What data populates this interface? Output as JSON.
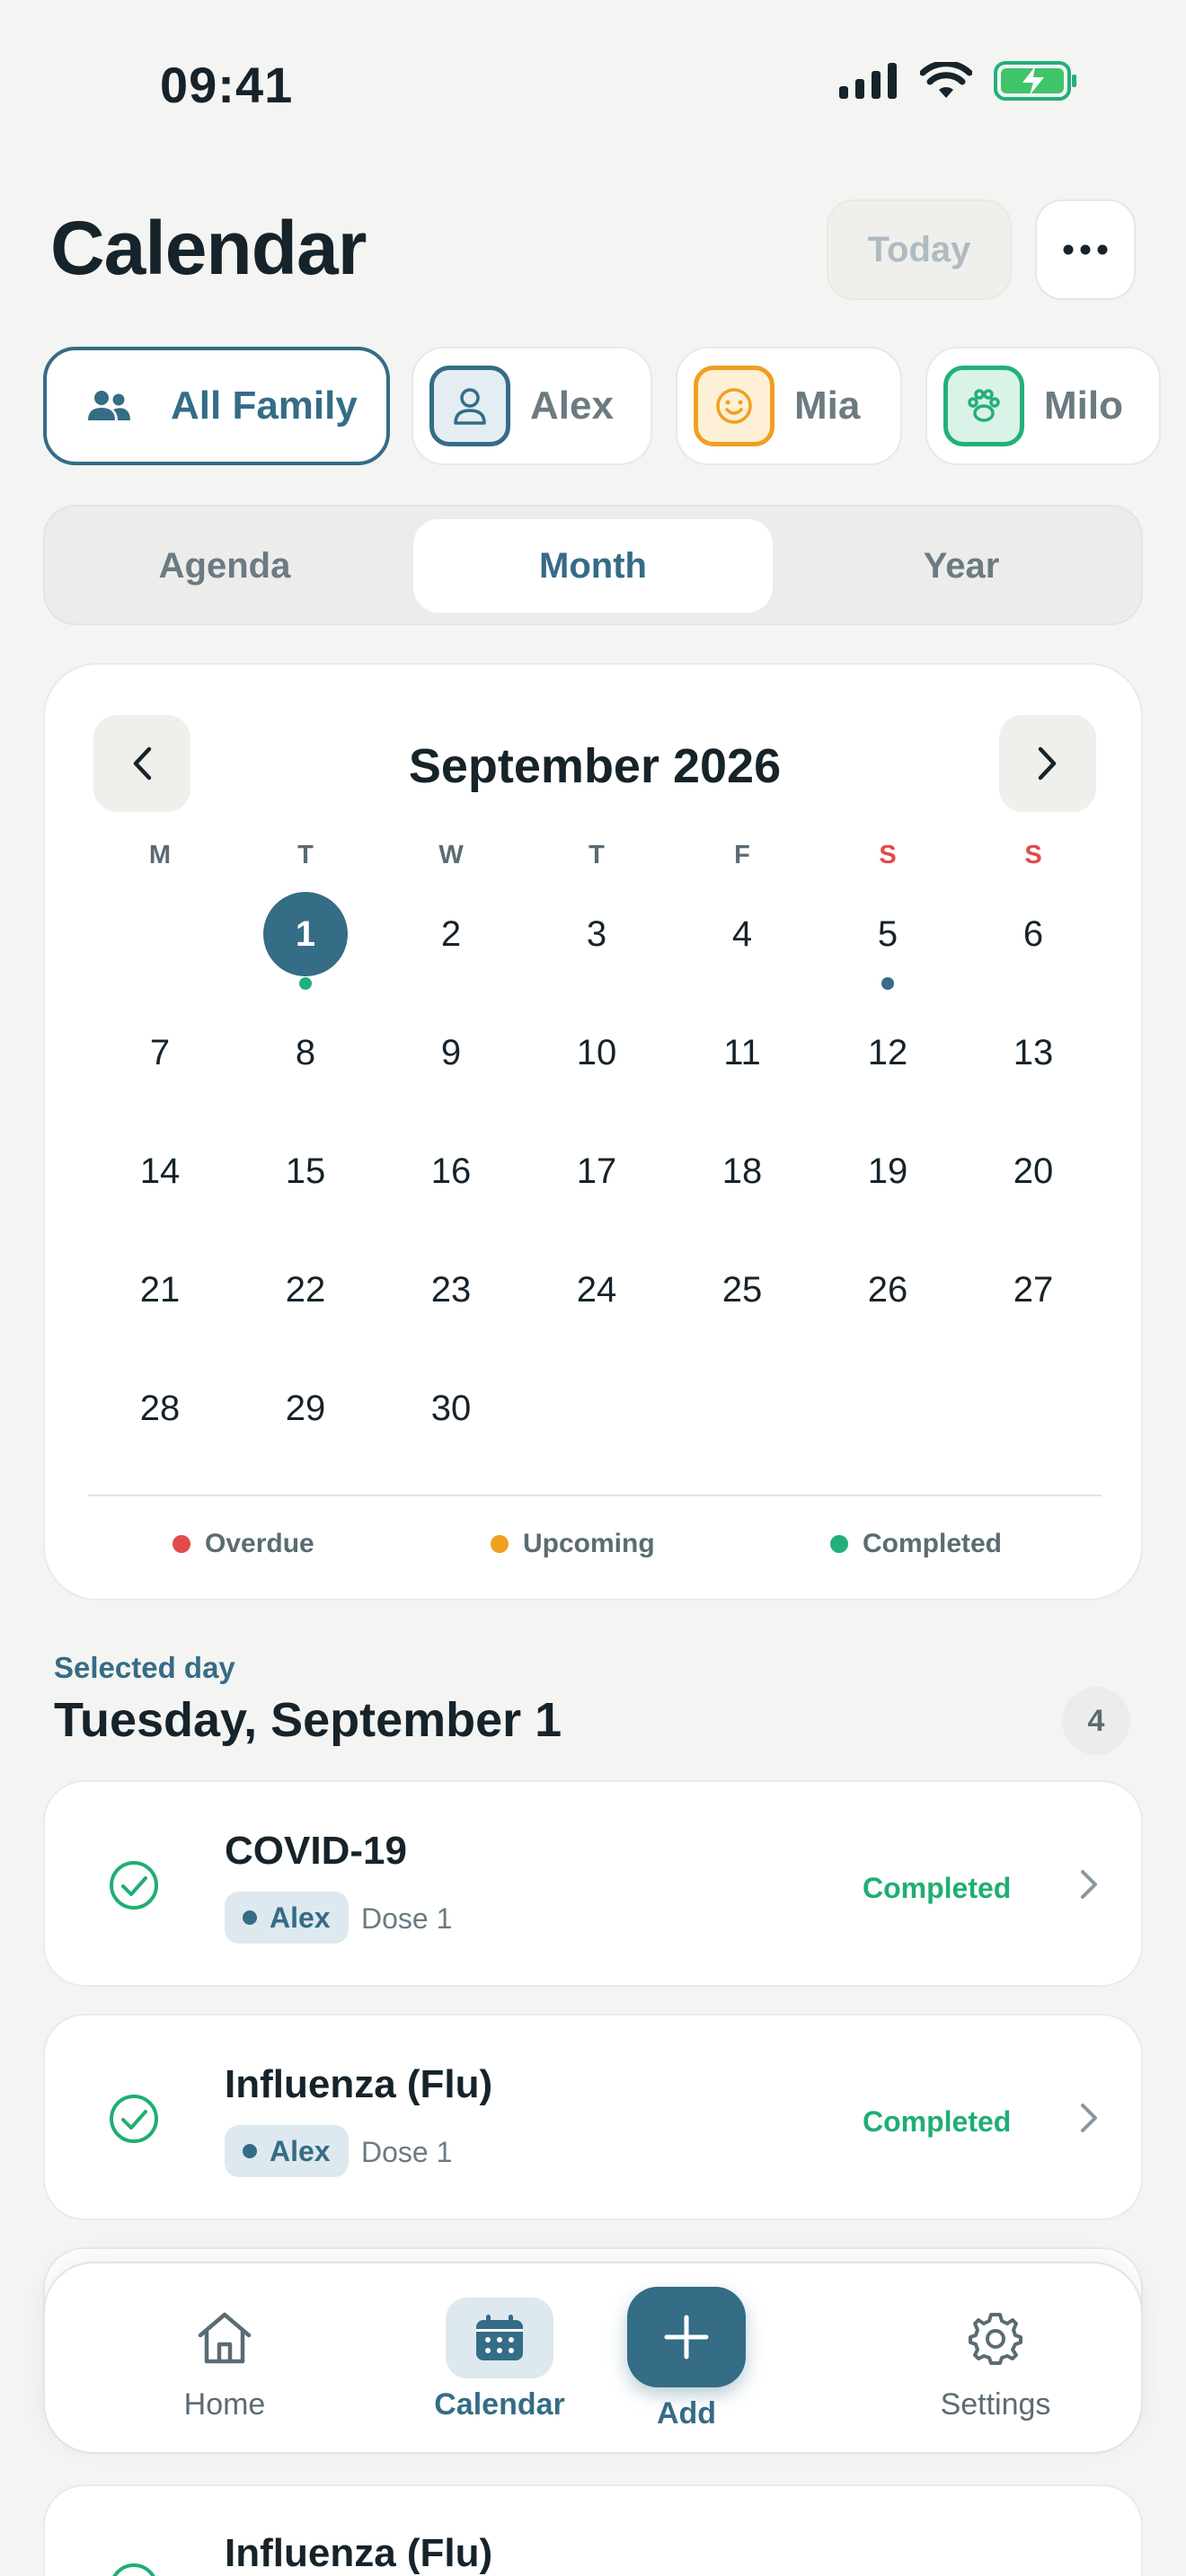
{
  "status_bar": {
    "time": "09:41"
  },
  "header": {
    "title": "Calendar",
    "today_label": "Today"
  },
  "family_filter": [
    {
      "label": "All Family",
      "active": true
    },
    {
      "label": "Alex",
      "color": "#356c86"
    },
    {
      "label": "Mia",
      "color": "#f0a020"
    },
    {
      "label": "Milo",
      "color": "#22b07a"
    }
  ],
  "views": [
    {
      "label": "Agenda"
    },
    {
      "label": "Month",
      "active": true
    },
    {
      "label": "Year"
    }
  ],
  "calendar": {
    "month_title": "September 2026",
    "weekdays": [
      "M",
      "T",
      "W",
      "T",
      "F",
      "S",
      "S"
    ],
    "days": [
      "1",
      "2",
      "3",
      "4",
      "5",
      "6",
      "7",
      "8",
      "9",
      "10",
      "11",
      "12",
      "13",
      "14",
      "15",
      "16",
      "17",
      "18",
      "19",
      "20",
      "21",
      "22",
      "23",
      "24",
      "25",
      "26",
      "27",
      "28",
      "29",
      "30"
    ],
    "selected_day": "1",
    "legend": [
      {
        "label": "Overdue",
        "color": "#e04b4b"
      },
      {
        "label": "Upcoming",
        "color": "#f0a020"
      },
      {
        "label": "Completed",
        "color": "#22b07a"
      }
    ]
  },
  "selected_day": {
    "label": "Selected day",
    "date": "Tuesday, September 1",
    "count": "4"
  },
  "events": [
    {
      "name": "COVID-19",
      "person": "Alex",
      "dose": "Dose 1",
      "status": "Completed"
    },
    {
      "name": "Influenza (Flu)",
      "person": "Alex",
      "dose": "Dose 1",
      "status": "Completed"
    },
    {
      "name": "Influenza (Flu)"
    }
  ],
  "tabbar": {
    "home": "Home",
    "calendar": "Calendar",
    "add": "Add",
    "settings": "Settings"
  },
  "colors": {
    "primary": "#356c86",
    "completed": "#1fae72",
    "weekend": "#e04b4b"
  }
}
